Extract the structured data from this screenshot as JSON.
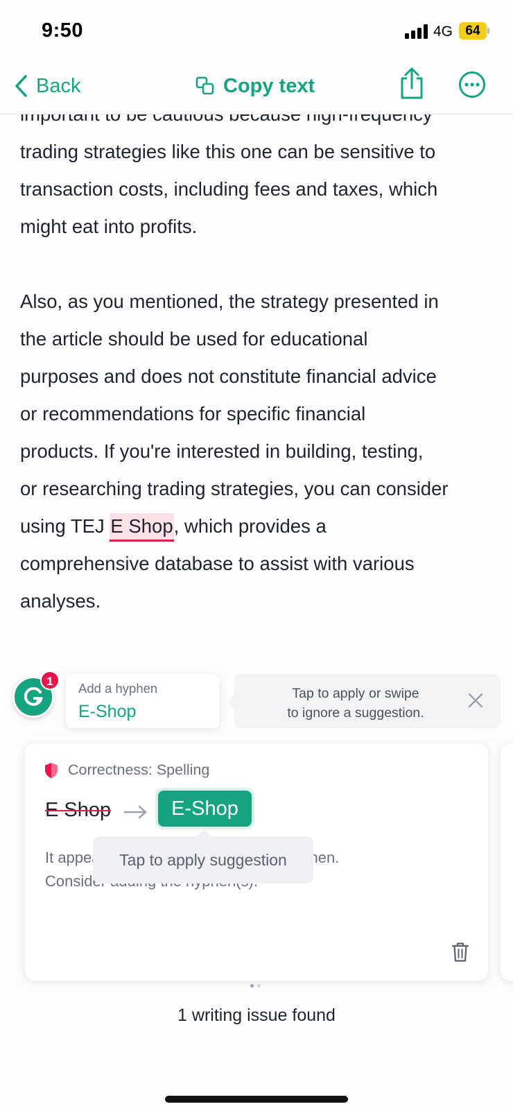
{
  "status": {
    "time": "9:50",
    "network": "4G",
    "battery": "64"
  },
  "nav": {
    "back_label": "Back",
    "copy_label": "Copy text"
  },
  "document": {
    "partial_top_line": "important to be cautious because high-frequency",
    "paragraph1": [
      "trading strategies like this one can be sensitive to",
      "transaction costs, including fees and taxes, which",
      "might eat into profits."
    ],
    "paragraph2": [
      "Also, as you mentioned, the strategy presented in",
      "the article should be used for educational",
      "purposes and does not constitute financial advice",
      "or recommendations for specific financial",
      "products. If you're interested in building, testing,",
      "or researching trading strategies, you can consider"
    ],
    "flag_line_before": "using TEJ ",
    "flag_word": "E Shop",
    "flag_line_after": ", which provides a",
    "paragraph2_end": [
      "comprehensive database to assist with various",
      "analyses."
    ]
  },
  "badge": {
    "count": "1"
  },
  "hint": {
    "title": "Add a hyphen",
    "value": "E-Shop"
  },
  "tooltip": {
    "line1": "Tap to apply or swipe",
    "line2": "to ignore a suggestion."
  },
  "card": {
    "category": "Correctness: Spelling",
    "original": "E Shop",
    "suggestion": "E-Shop",
    "desc_line1": "It appears that E Shop is missing a hyphen.",
    "desc_line2": "Consider adding the hyphen(s).",
    "apply_tip": "Tap to apply suggestion"
  },
  "footer": {
    "issues": "1 writing issue found"
  },
  "colors": {
    "accent": "#15a47f",
    "error": "#dc1f4b",
    "badge": "#e5164c",
    "battery": "#f4cc1a"
  },
  "icons": [
    "chevron-left-icon",
    "copy-icon",
    "share-icon",
    "more-icon",
    "grammarly-icon",
    "close-icon",
    "shield-icon",
    "arrow-right-icon",
    "trash-icon"
  ]
}
